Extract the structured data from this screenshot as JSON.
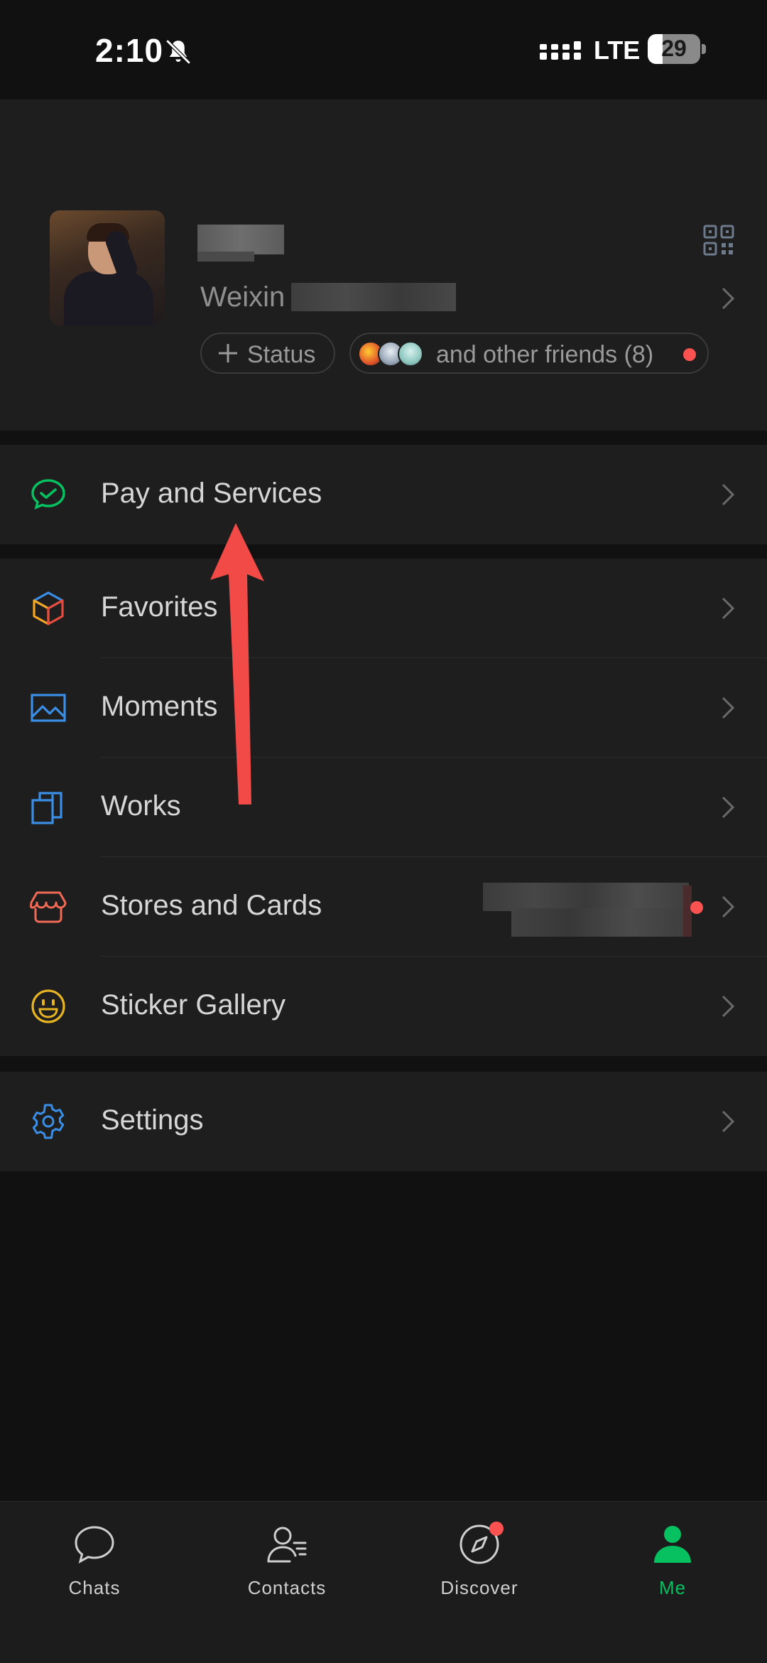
{
  "status_bar": {
    "time": "2:10",
    "network": "LTE",
    "battery": "29",
    "battery_level": 0.29
  },
  "profile": {
    "weixin_label": "Weixin",
    "status_button": "Status",
    "friends_text": "and other friends (8)"
  },
  "menu": {
    "pay": "Pay and Services",
    "favorites": "Favorites",
    "moments": "Moments",
    "works": "Works",
    "stores": "Stores and Cards",
    "stickers": "Sticker Gallery",
    "settings": "Settings"
  },
  "tabs": [
    {
      "label": "Chats"
    },
    {
      "label": "Contacts"
    },
    {
      "label": "Discover"
    },
    {
      "label": "Me"
    }
  ],
  "colors": {
    "accent": "#07c160",
    "badge": "#fa5151",
    "annotation_arrow": "#f24a46",
    "favorites_icon": [
      "#f5a623",
      "#3a8ee6",
      "#e84c3d"
    ],
    "moments_icon": "#3a8ee6",
    "works_icon": "#3a8ee6",
    "stores_icon": "#f06a55",
    "stickers_icon": "#e6b422",
    "settings_icon": "#3a8ee6"
  },
  "icons": {
    "status_bar": [
      "mute-bell-icon",
      "signal-icon",
      "battery-icon"
    ],
    "profile": [
      "qr-code-icon",
      "chevron-right-icon",
      "plus-icon"
    ],
    "menu": [
      "pay-icon",
      "favorites-cube-icon",
      "moments-image-icon",
      "works-icon",
      "stores-icon",
      "sticker-smile-icon",
      "settings-gear-icon"
    ],
    "tabs": [
      "chat-bubble-icon",
      "contacts-icon",
      "compass-icon",
      "person-icon"
    ]
  }
}
